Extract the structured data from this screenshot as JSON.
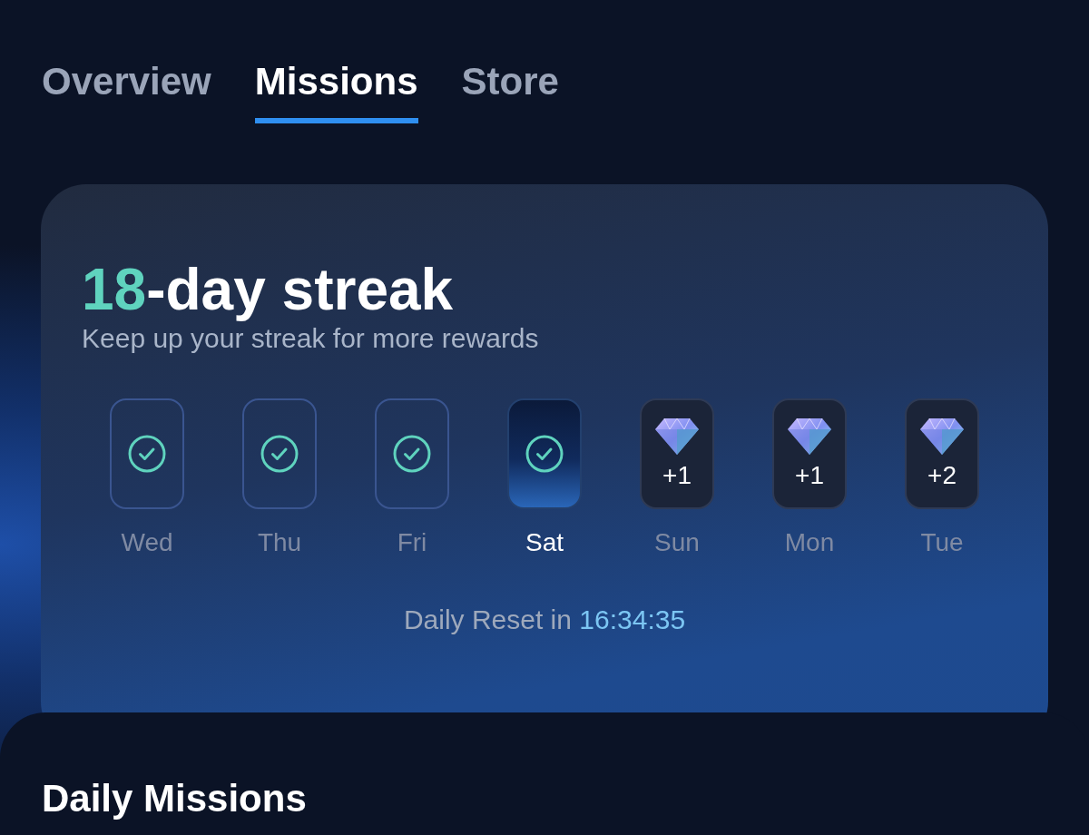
{
  "tabs": [
    {
      "label": "Overview",
      "selected": false
    },
    {
      "label": "Missions",
      "selected": true
    },
    {
      "label": "Store",
      "selected": false
    }
  ],
  "streak": {
    "count": "18",
    "title_rest": "-day streak",
    "subtitle": "Keep up your streak for more rewards"
  },
  "days": [
    {
      "label": "Wed",
      "kind": "done",
      "selected": false
    },
    {
      "label": "Thu",
      "kind": "done",
      "selected": false
    },
    {
      "label": "Fri",
      "kind": "done",
      "selected": false
    },
    {
      "label": "Sat",
      "kind": "done",
      "selected": true
    },
    {
      "label": "Sun",
      "kind": "reward",
      "reward": "+1",
      "selected": false
    },
    {
      "label": "Mon",
      "kind": "reward",
      "reward": "+1",
      "selected": false
    },
    {
      "label": "Tue",
      "kind": "reward",
      "reward": "+2",
      "selected": false
    }
  ],
  "reset": {
    "label": "Daily Reset in",
    "time": "16:34:35"
  },
  "daily_missions": {
    "title": "Daily Missions"
  }
}
